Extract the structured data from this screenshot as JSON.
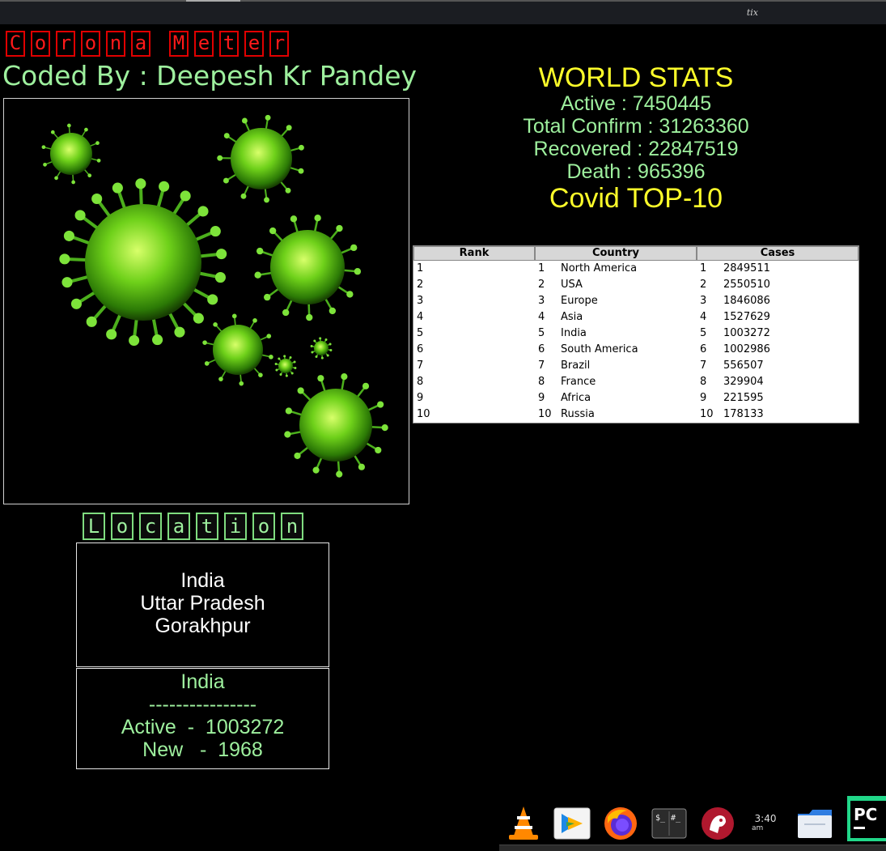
{
  "window": {
    "title": "tix"
  },
  "app": {
    "title_letters": [
      "C",
      "o",
      "r",
      "o",
      "n",
      "a",
      "M",
      "e",
      "t",
      "e",
      "r"
    ],
    "coded_by": "Coded By : Deepesh Kr Pandey",
    "location_letters": [
      "L",
      "o",
      "c",
      "a",
      "t",
      "i",
      "o",
      "n"
    ]
  },
  "world_stats": {
    "heading": "WORLD STATS",
    "active": "Active : 7450445",
    "total_confirm": "Total Confirm : 31263360",
    "recovered": "Recovered : 22847519",
    "death": "Death : 965396",
    "top10_heading": "Covid TOP-10"
  },
  "table": {
    "headers": [
      "Rank",
      "Country",
      "Cases"
    ],
    "rows": [
      {
        "rank": "1",
        "n": "1",
        "country": "North America",
        "n2": "1",
        "cases": "2849511"
      },
      {
        "rank": "2",
        "n": "2",
        "country": "USA",
        "n2": "2",
        "cases": "2550510"
      },
      {
        "rank": "3",
        "n": "3",
        "country": "Europe",
        "n2": "3",
        "cases": "1846086"
      },
      {
        "rank": "4",
        "n": "4",
        "country": "Asia",
        "n2": "4",
        "cases": "1527629"
      },
      {
        "rank": "5",
        "n": "5",
        "country": "India",
        "n2": "5",
        "cases": "1003272"
      },
      {
        "rank": "6",
        "n": "6",
        "country": "South America",
        "n2": "6",
        "cases": "1002986"
      },
      {
        "rank": "7",
        "n": "7",
        "country": "Brazil",
        "n2": "7",
        "cases": "556507"
      },
      {
        "rank": "8",
        "n": "8",
        "country": "France",
        "n2": "8",
        "cases": "329904"
      },
      {
        "rank": "9",
        "n": "9",
        "country": "Africa",
        "n2": "9",
        "cases": "221595"
      },
      {
        "rank": "10",
        "n": "10",
        "country": "Russia",
        "n2": "10",
        "cases": "178133"
      }
    ]
  },
  "location": {
    "country": "India",
    "state": "Uttar Pradesh",
    "city": "Gorakhpur"
  },
  "country_info": {
    "name": "India",
    "divider": "----------------",
    "active": "Active  -  1003272",
    "new": "New   -  1968"
  },
  "taskbar": {
    "time": "3:40",
    "ampm": "am",
    "apps": [
      "vlc-icon",
      "playonlinux-icon",
      "firefox-icon",
      "terminal-icon",
      "gimp-icon",
      "files-icon",
      "pycharm-icon"
    ]
  },
  "colors": {
    "title_red": "#ff1a1a",
    "green": "#9ef09e",
    "yellow": "#ffff2a"
  }
}
